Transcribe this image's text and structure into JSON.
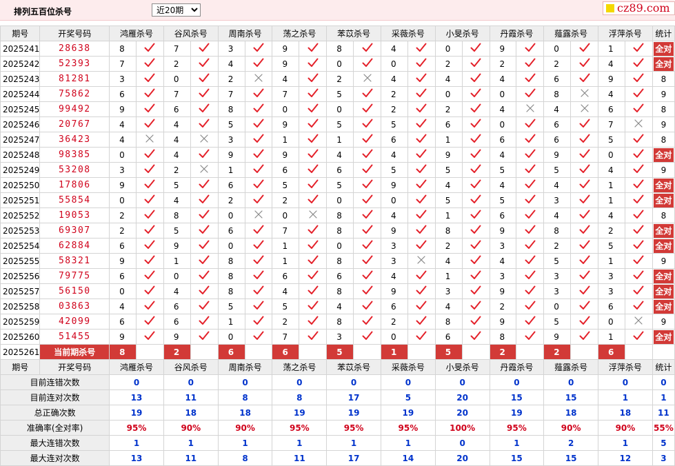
{
  "header": {
    "title": "排列五百位杀号",
    "period_select": "近20期",
    "site_logo": "cz89.com"
  },
  "columns": {
    "issue": "期号",
    "draw": "开奖号码",
    "killers": [
      "鸿雁杀号",
      "谷风杀号",
      "周南杀号",
      "荡之杀号",
      "苯苡杀号",
      "采薇杀号",
      "小旻杀号",
      "丹霞杀号",
      "薤露杀号",
      "浮萍杀号"
    ],
    "stat": "统计"
  },
  "rows": [
    {
      "issue": "2025241",
      "draw": "28638",
      "digits": [
        "8",
        "7",
        "3",
        "9",
        "8",
        "4",
        "0",
        "9",
        "0",
        "1"
      ],
      "marks": [
        "check",
        "check",
        "check",
        "check",
        "check",
        "check",
        "check",
        "check",
        "check",
        "check"
      ],
      "stat": "全对"
    },
    {
      "issue": "2025242",
      "draw": "52393",
      "digits": [
        "7",
        "2",
        "4",
        "9",
        "0",
        "0",
        "2",
        "2",
        "2",
        "4"
      ],
      "marks": [
        "check",
        "check",
        "check",
        "check",
        "check",
        "check",
        "check",
        "check",
        "check",
        "check"
      ],
      "stat": "全对"
    },
    {
      "issue": "2025243",
      "draw": "81281",
      "digits": [
        "3",
        "0",
        "2",
        "4",
        "2",
        "4",
        "4",
        "4",
        "6",
        "9"
      ],
      "marks": [
        "check",
        "check",
        "cross",
        "check",
        "cross",
        "check",
        "check",
        "check",
        "check",
        "check"
      ],
      "stat": "8"
    },
    {
      "issue": "2025244",
      "draw": "75862",
      "digits": [
        "6",
        "7",
        "7",
        "7",
        "5",
        "2",
        "0",
        "0",
        "8",
        "4"
      ],
      "marks": [
        "check",
        "check",
        "check",
        "check",
        "check",
        "check",
        "check",
        "check",
        "cross",
        "check"
      ],
      "stat": "9"
    },
    {
      "issue": "2025245",
      "draw": "99492",
      "digits": [
        "9",
        "6",
        "8",
        "0",
        "0",
        "2",
        "2",
        "4",
        "4",
        "6"
      ],
      "marks": [
        "check",
        "check",
        "check",
        "check",
        "check",
        "check",
        "check",
        "cross",
        "cross",
        "check"
      ],
      "stat": "8"
    },
    {
      "issue": "2025246",
      "draw": "20767",
      "digits": [
        "4",
        "4",
        "5",
        "9",
        "5",
        "5",
        "6",
        "0",
        "6",
        "7"
      ],
      "marks": [
        "check",
        "check",
        "check",
        "check",
        "check",
        "check",
        "check",
        "check",
        "check",
        "cross"
      ],
      "stat": "9"
    },
    {
      "issue": "2025247",
      "draw": "36423",
      "digits": [
        "4",
        "4",
        "3",
        "1",
        "1",
        "6",
        "1",
        "6",
        "6",
        "5"
      ],
      "marks": [
        "cross",
        "cross",
        "check",
        "check",
        "check",
        "check",
        "check",
        "check",
        "check",
        "check"
      ],
      "stat": "8"
    },
    {
      "issue": "2025248",
      "draw": "98385",
      "digits": [
        "0",
        "4",
        "9",
        "9",
        "4",
        "4",
        "9",
        "4",
        "9",
        "0"
      ],
      "marks": [
        "check",
        "check",
        "check",
        "check",
        "check",
        "check",
        "check",
        "check",
        "check",
        "check"
      ],
      "stat": "全对"
    },
    {
      "issue": "2025249",
      "draw": "53208",
      "digits": [
        "3",
        "2",
        "1",
        "6",
        "6",
        "5",
        "5",
        "5",
        "5",
        "4"
      ],
      "marks": [
        "check",
        "cross",
        "check",
        "check",
        "check",
        "check",
        "check",
        "check",
        "check",
        "check"
      ],
      "stat": "9"
    },
    {
      "issue": "2025250",
      "draw": "17806",
      "digits": [
        "9",
        "5",
        "6",
        "5",
        "5",
        "9",
        "4",
        "4",
        "4",
        "1"
      ],
      "marks": [
        "check",
        "check",
        "check",
        "check",
        "check",
        "check",
        "check",
        "check",
        "check",
        "check"
      ],
      "stat": "全对"
    },
    {
      "issue": "2025251",
      "draw": "55854",
      "digits": [
        "0",
        "4",
        "2",
        "2",
        "0",
        "0",
        "5",
        "5",
        "3",
        "1"
      ],
      "marks": [
        "check",
        "check",
        "check",
        "check",
        "check",
        "check",
        "check",
        "check",
        "check",
        "check"
      ],
      "stat": "全对"
    },
    {
      "issue": "2025252",
      "draw": "19053",
      "digits": [
        "2",
        "8",
        "0",
        "0",
        "8",
        "4",
        "1",
        "6",
        "4",
        "4"
      ],
      "marks": [
        "check",
        "check",
        "cross",
        "cross",
        "check",
        "check",
        "check",
        "check",
        "check",
        "check"
      ],
      "stat": "8"
    },
    {
      "issue": "2025253",
      "draw": "69307",
      "digits": [
        "2",
        "5",
        "6",
        "7",
        "8",
        "9",
        "8",
        "9",
        "8",
        "2"
      ],
      "marks": [
        "check",
        "check",
        "check",
        "check",
        "check",
        "check",
        "check",
        "check",
        "check",
        "check"
      ],
      "stat": "全对"
    },
    {
      "issue": "2025254",
      "draw": "62884",
      "digits": [
        "6",
        "9",
        "0",
        "1",
        "0",
        "3",
        "2",
        "3",
        "2",
        "5"
      ],
      "marks": [
        "check",
        "check",
        "check",
        "check",
        "check",
        "check",
        "check",
        "check",
        "check",
        "check"
      ],
      "stat": "全对"
    },
    {
      "issue": "2025255",
      "draw": "58321",
      "digits": [
        "9",
        "1",
        "8",
        "1",
        "8",
        "3",
        "4",
        "4",
        "5",
        "1"
      ],
      "marks": [
        "check",
        "check",
        "check",
        "check",
        "check",
        "cross",
        "check",
        "check",
        "check",
        "check"
      ],
      "stat": "9"
    },
    {
      "issue": "2025256",
      "draw": "79775",
      "digits": [
        "6",
        "0",
        "8",
        "6",
        "6",
        "4",
        "1",
        "3",
        "3",
        "3"
      ],
      "marks": [
        "check",
        "check",
        "check",
        "check",
        "check",
        "check",
        "check",
        "check",
        "check",
        "check"
      ],
      "stat": "全对"
    },
    {
      "issue": "2025257",
      "draw": "56150",
      "digits": [
        "0",
        "4",
        "8",
        "4",
        "8",
        "9",
        "3",
        "9",
        "3",
        "3"
      ],
      "marks": [
        "check",
        "check",
        "check",
        "check",
        "check",
        "check",
        "check",
        "check",
        "check",
        "check"
      ],
      "stat": "全对"
    },
    {
      "issue": "2025258",
      "draw": "03863",
      "digits": [
        "4",
        "6",
        "5",
        "5",
        "4",
        "6",
        "4",
        "2",
        "0",
        "6"
      ],
      "marks": [
        "check",
        "check",
        "check",
        "check",
        "check",
        "check",
        "check",
        "check",
        "check",
        "check"
      ],
      "stat": "全对"
    },
    {
      "issue": "2025259",
      "draw": "42099",
      "digits": [
        "6",
        "6",
        "1",
        "2",
        "8",
        "2",
        "8",
        "9",
        "5",
        "0"
      ],
      "marks": [
        "check",
        "check",
        "check",
        "check",
        "check",
        "check",
        "check",
        "check",
        "check",
        "cross"
      ],
      "stat": "9"
    },
    {
      "issue": "2025260",
      "draw": "51455",
      "digits": [
        "9",
        "9",
        "0",
        "7",
        "3",
        "0",
        "6",
        "8",
        "9",
        "1"
      ],
      "marks": [
        "check",
        "check",
        "check",
        "check",
        "check",
        "check",
        "check",
        "check",
        "check",
        "check"
      ],
      "stat": "全对"
    }
  ],
  "current": {
    "issue": "2025261",
    "label": "当前期杀号",
    "digits": [
      "8",
      "2",
      "6",
      "6",
      "5",
      "1",
      "5",
      "2",
      "2",
      "6"
    ]
  },
  "summary": [
    {
      "label": "目前连错次数",
      "values": [
        "0",
        "0",
        "0",
        "0",
        "0",
        "0",
        "0",
        "0",
        "0",
        "0"
      ],
      "stat": "0"
    },
    {
      "label": "目前连对次数",
      "values": [
        "13",
        "11",
        "8",
        "8",
        "17",
        "5",
        "20",
        "15",
        "15",
        "1"
      ],
      "stat": "1"
    },
    {
      "label": "总正确次数",
      "values": [
        "19",
        "18",
        "18",
        "19",
        "19",
        "19",
        "20",
        "19",
        "18",
        "18"
      ],
      "stat": "11"
    },
    {
      "label": "准确率(全对率)",
      "values": [
        "95%",
        "90%",
        "90%",
        "95%",
        "95%",
        "95%",
        "100%",
        "95%",
        "90%",
        "90%"
      ],
      "stat": "55%"
    },
    {
      "label": "最大连错次数",
      "values": [
        "1",
        "1",
        "1",
        "1",
        "1",
        "1",
        "0",
        "1",
        "2",
        "1"
      ],
      "stat": "5"
    },
    {
      "label": "最大连对次数",
      "values": [
        "13",
        "11",
        "8",
        "11",
        "17",
        "14",
        "20",
        "15",
        "15",
        "12"
      ],
      "stat": "3"
    }
  ],
  "colors": {
    "check": "#e4212a",
    "cross": "#888888",
    "accent": "#d23a37",
    "summary_value": "#0033cc",
    "rate_value": "#d0021b"
  }
}
